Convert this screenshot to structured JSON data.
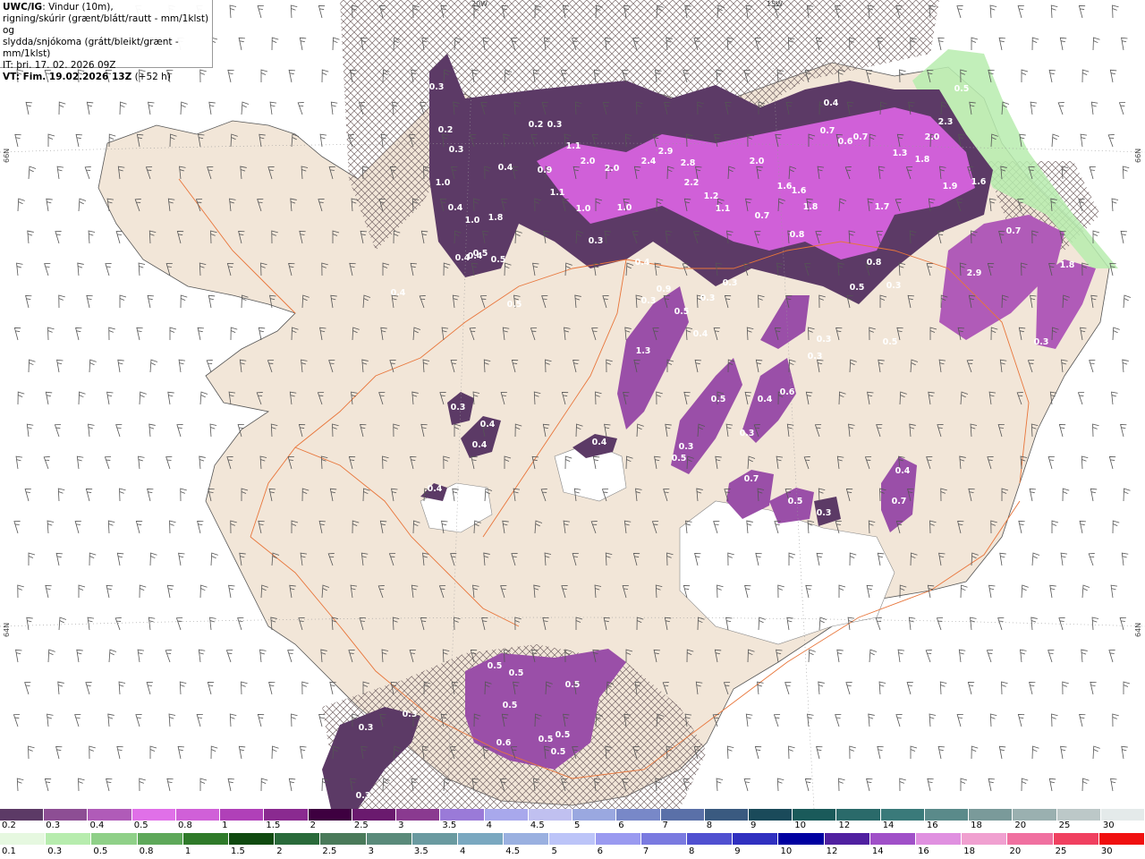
{
  "title": {
    "model": "UWC/IG",
    "line1": ": Vindur (10m),",
    "line2": "rigning/skúrir (grænt/blátt/rautt - mm/1klst) og",
    "line3": "slydda/snjókoma (grátt/bleikt/grænt - mm/1klst)",
    "line4": "IT: þri. 17. 02. 2026 09Z",
    "line5_bold": "VT: Fim. 19.02.2026 13Z",
    "line5_rest": " (+52 h)"
  },
  "graticule": {
    "lat_top": "66N",
    "lat_bottom": "64N",
    "lon_a": "20W",
    "lon_b": "15W"
  },
  "colors": {
    "land": "#f2e6d8",
    "sea": "#ffffff",
    "glacier": "#ffffff",
    "road": "#e8753a",
    "snow_dark": "#5c3a66",
    "snow_mid": "#9a4fa8",
    "snow_bright": "#e070e8",
    "rain_green": "#b7ecae"
  },
  "precip_labels": [
    "0.3",
    "0.2",
    "0.3",
    "0.2",
    "0.3",
    "0.4",
    "1.0",
    "0.4",
    "1.8",
    "1.0",
    "0.5",
    "0.4",
    "0.5",
    "0.4",
    "0.5",
    "0.9",
    "1.1",
    "1.1",
    "2.0",
    "2.0",
    "1.0",
    "1.0",
    "0.3",
    "2.9",
    "2.4",
    "2.8",
    "2.2",
    "1.2",
    "1.1",
    "0.7",
    "2.0",
    "1.6",
    "1.6",
    "1.8",
    "0.8",
    "0.7",
    "0.7",
    "0.6",
    "0.4",
    "1.3",
    "1.8",
    "2.0",
    "2.3",
    "1.9",
    "1.6",
    "0.5",
    "1.7",
    "0.8",
    "0.5",
    "0.3",
    "0.7",
    "2.9",
    "1.8",
    "0.3",
    "0.4",
    "0.4",
    "0.9",
    "0.5",
    "0.3",
    "0.4",
    "1.3",
    "0.3",
    "0.3",
    "0.5",
    "0.3",
    "0.3",
    "0.5",
    "0.6",
    "0.4",
    "0.3",
    "0.3",
    "0.5",
    "0.4",
    "0.4",
    "0.3",
    "0.4",
    "0.4",
    "0.7",
    "0.5",
    "0.3",
    "0.4",
    "0.7",
    "0.5",
    "0.5",
    "0.5",
    "0.5",
    "0.5",
    "0.5",
    "0.5",
    "0.6",
    "0.3",
    "0.3",
    "0.3"
  ],
  "legend_snow": {
    "labels": [
      "0.2",
      "0.3",
      "0.4",
      "0.5",
      "0.8",
      "1",
      "1.5",
      "2",
      "2.5",
      "3",
      "3.5",
      "4",
      "4.5",
      "5",
      "6",
      "7",
      "8",
      "9",
      "10",
      "12",
      "14",
      "16",
      "18",
      "20",
      "25",
      "30"
    ],
    "colors": [
      "#5c3a66",
      "#8d4e94",
      "#b05bb8",
      "#e070e8",
      "#d060d8",
      "#b040b8",
      "#8a2a90",
      "#3e0040",
      "#6a1a6e",
      "#8a3a90",
      "#9a7ad8",
      "#a8a8ec",
      "#c0c0f0",
      "#9aa8e0",
      "#7888c8",
      "#5a70a8",
      "#3a5a80",
      "#1a4a5a",
      "#1a5a5a",
      "#2a6a6a",
      "#3a7a7a",
      "#5a8a8a",
      "#7a9a9a",
      "#9ab0b0",
      "#bcc8c8",
      "#e4eaea"
    ]
  },
  "legend_rain": {
    "labels": [
      "0.1",
      "0.3",
      "0.5",
      "0.8",
      "1",
      "1.5",
      "2",
      "2.5",
      "3",
      "3.5",
      "4",
      "4.5",
      "5",
      "6",
      "7",
      "8",
      "9",
      "10",
      "12",
      "14",
      "16",
      "18",
      "20",
      "25",
      "30"
    ],
    "colors": [
      "#e6f8e0",
      "#b7ecae",
      "#8fd088",
      "#5ea85a",
      "#2f7a2a",
      "#104a10",
      "#2a6a3a",
      "#4a7a5a",
      "#5a8a7a",
      "#6a9aa0",
      "#7aa8c0",
      "#9ab0e0",
      "#bcc4f8",
      "#9a9af0",
      "#7a7ae0",
      "#5050d0",
      "#3030c0",
      "#0000a0",
      "#5020a0",
      "#a050c8",
      "#e090e0",
      "#f0a0d0",
      "#f070a0",
      "#f04060",
      "#f01010"
    ]
  }
}
